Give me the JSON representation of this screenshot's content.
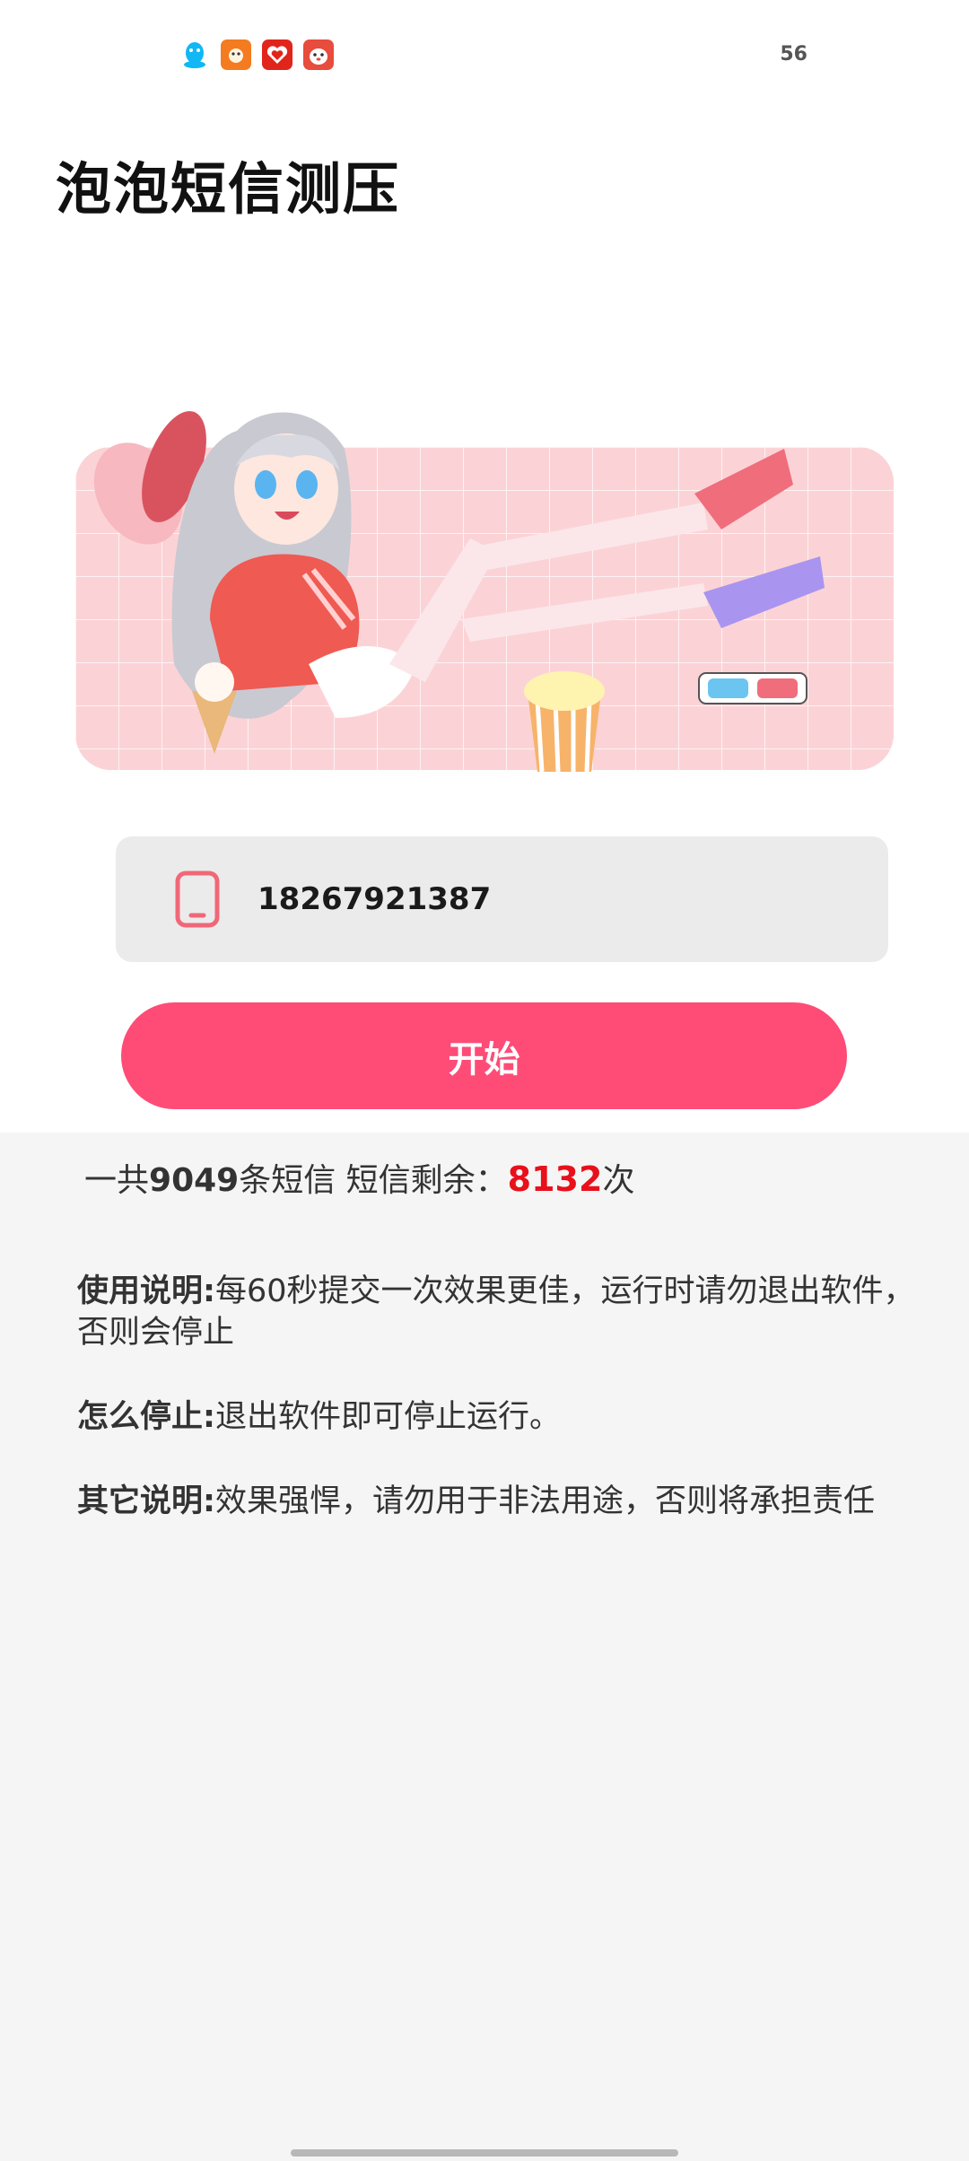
{
  "status_bar": {
    "icons": [
      "qq-icon",
      "squirrel-app-icon",
      "heart-app-icon",
      "dog-app-icon"
    ],
    "right_text": "56"
  },
  "title": "泡泡短信测压",
  "phone_input": {
    "value": "18267921387",
    "icon": "phone-icon"
  },
  "start_button": {
    "label": "开始"
  },
  "stats": {
    "prefix": "一共",
    "total": "9049",
    "middle": "条短信 短信剩余：",
    "remaining": "8132",
    "suffix": "次"
  },
  "notes": [
    {
      "key": "使用说明:",
      "text": "每60秒提交一次效果更佳，运行时请勿退出软件，否则会停止"
    },
    {
      "key": "怎么停止:",
      "text": "退出软件即可停止运行。"
    },
    {
      "key": "其它说明:",
      "text": "效果强悍，请勿用于非法用途，否则将承担责任"
    }
  ],
  "colors": {
    "accent": "#fe4c77",
    "remaining_red": "#e8101a",
    "banner_bg": "#fbd3d6"
  }
}
